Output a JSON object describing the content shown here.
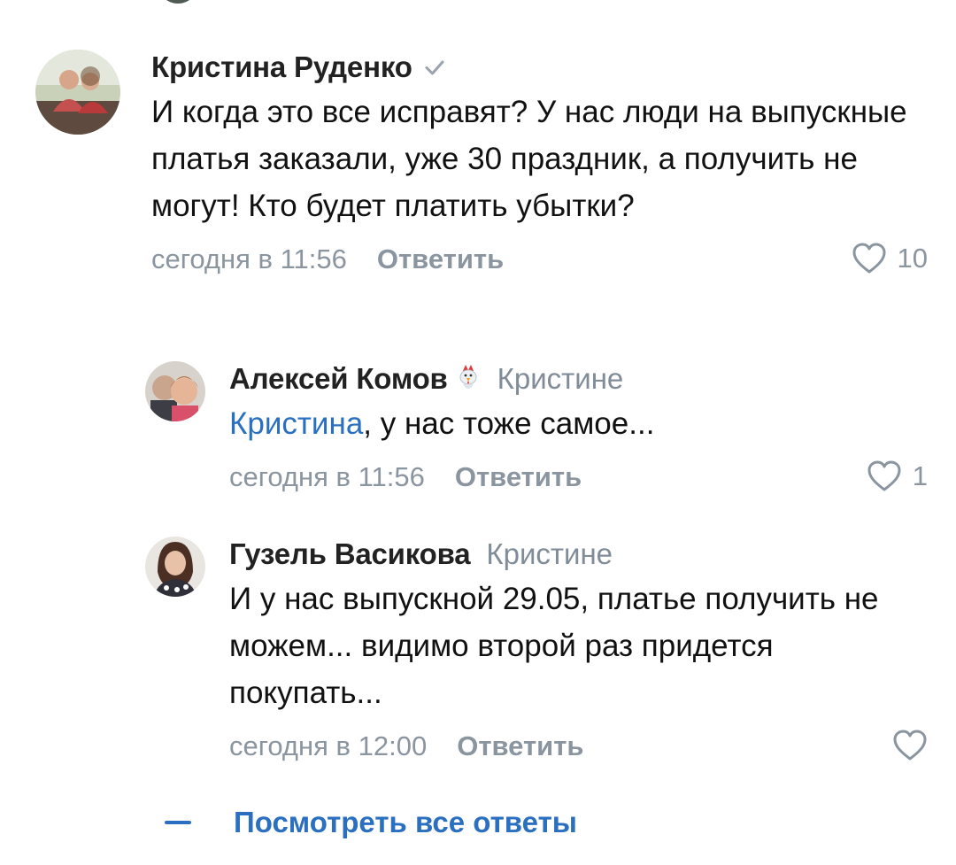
{
  "comments": [
    {
      "author": "Кристина Руденко",
      "text": "И когда это все исправят? У нас люди на выпускные платья заказали, уже 30 праздник, а получить не могут! Кто будет платить убытки?",
      "time": "сегодня в 11:56",
      "reply_label": "Ответить",
      "likes": "10",
      "icons": {
        "avatar": "user-avatar-photo",
        "badge": "verified-check-icon",
        "like": "heart-icon"
      }
    },
    {
      "author": "Алексей Комов",
      "reply_to": "Кристине",
      "mention": "Кристина",
      "text": ", у нас тоже самое...",
      "time": "сегодня в 11:56",
      "reply_label": "Ответить",
      "likes": "1",
      "icons": {
        "avatar": "user-avatar-photo",
        "status": "rooster-emoji-icon",
        "like": "heart-icon"
      }
    },
    {
      "author": "Гузель Васикова",
      "reply_to": "Кристине",
      "text": "И у нас выпускной 29.05, платье получить не можем... видимо второй раз придется покупать...",
      "time": "сегодня в 12:00",
      "reply_label": "Ответить",
      "likes": "",
      "icons": {
        "avatar": "user-avatar-photo",
        "like": "heart-icon"
      }
    }
  ],
  "show_all_replies": "Посмотреть все ответы",
  "colors": {
    "link": "#2a6fc0",
    "secondary_text": "#818c99",
    "meta_text": "#8b95a0",
    "primary_text": "#111111"
  }
}
